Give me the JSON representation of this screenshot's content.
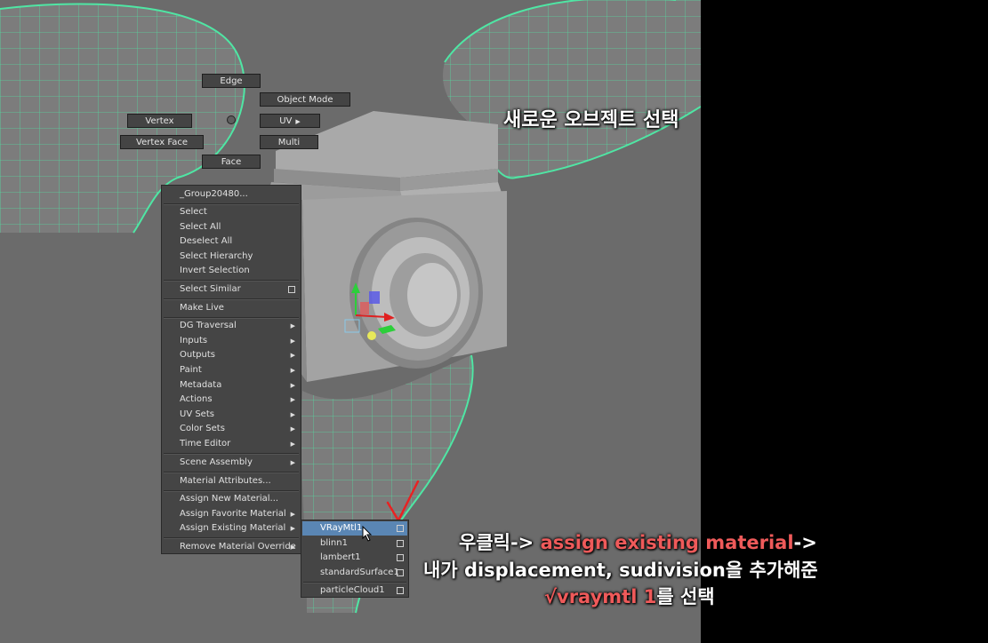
{
  "colors": {
    "wireframe": "#4fe6a4",
    "highlight": "#5a86b4",
    "annotation_accent": "#ef5a5a",
    "checkmark": "#e82222"
  },
  "marking_menu": {
    "edge": "Edge",
    "object_mode": "Object Mode",
    "vertex": "Vertex",
    "uv": "UV",
    "vertex_face": "Vertex Face",
    "multi": "Multi",
    "face": "Face"
  },
  "context_menu": {
    "title": "_Group20480...",
    "items": {
      "select": "Select",
      "select_all": "Select All",
      "deselect_all": "Deselect All",
      "select_hierarchy": "Select Hierarchy",
      "invert_selection": "Invert Selection",
      "select_similar": "Select Similar",
      "make_live": "Make Live",
      "dg_traversal": "DG Traversal",
      "inputs": "Inputs",
      "outputs": "Outputs",
      "paint": "Paint",
      "metadata": "Metadata",
      "actions": "Actions",
      "uv_sets": "UV Sets",
      "color_sets": "Color Sets",
      "time_editor": "Time Editor",
      "scene_assembly": "Scene Assembly",
      "material_attributes": "Material Attributes...",
      "assign_new_material": "Assign New Material...",
      "assign_favorite_material": "Assign Favorite Material",
      "assign_existing_material": "Assign Existing Material",
      "remove_material_override": "Remove Material Override"
    }
  },
  "submenu": {
    "items": [
      "VRayMtl1",
      "blinn1",
      "lambert1",
      "standardSurface1",
      "particleCloud1"
    ],
    "highlighted": "VRayMtl1"
  },
  "annotations": {
    "top": "새로운 오브젝트 선택",
    "line1_a": "우클릭-> ",
    "line1_b": "assign existing material",
    "line1_c": "->",
    "line2": "내가 displacement, sudivision을 추가해준",
    "line3_a": "vraymtl 1",
    "line3_b": "를 선택"
  }
}
